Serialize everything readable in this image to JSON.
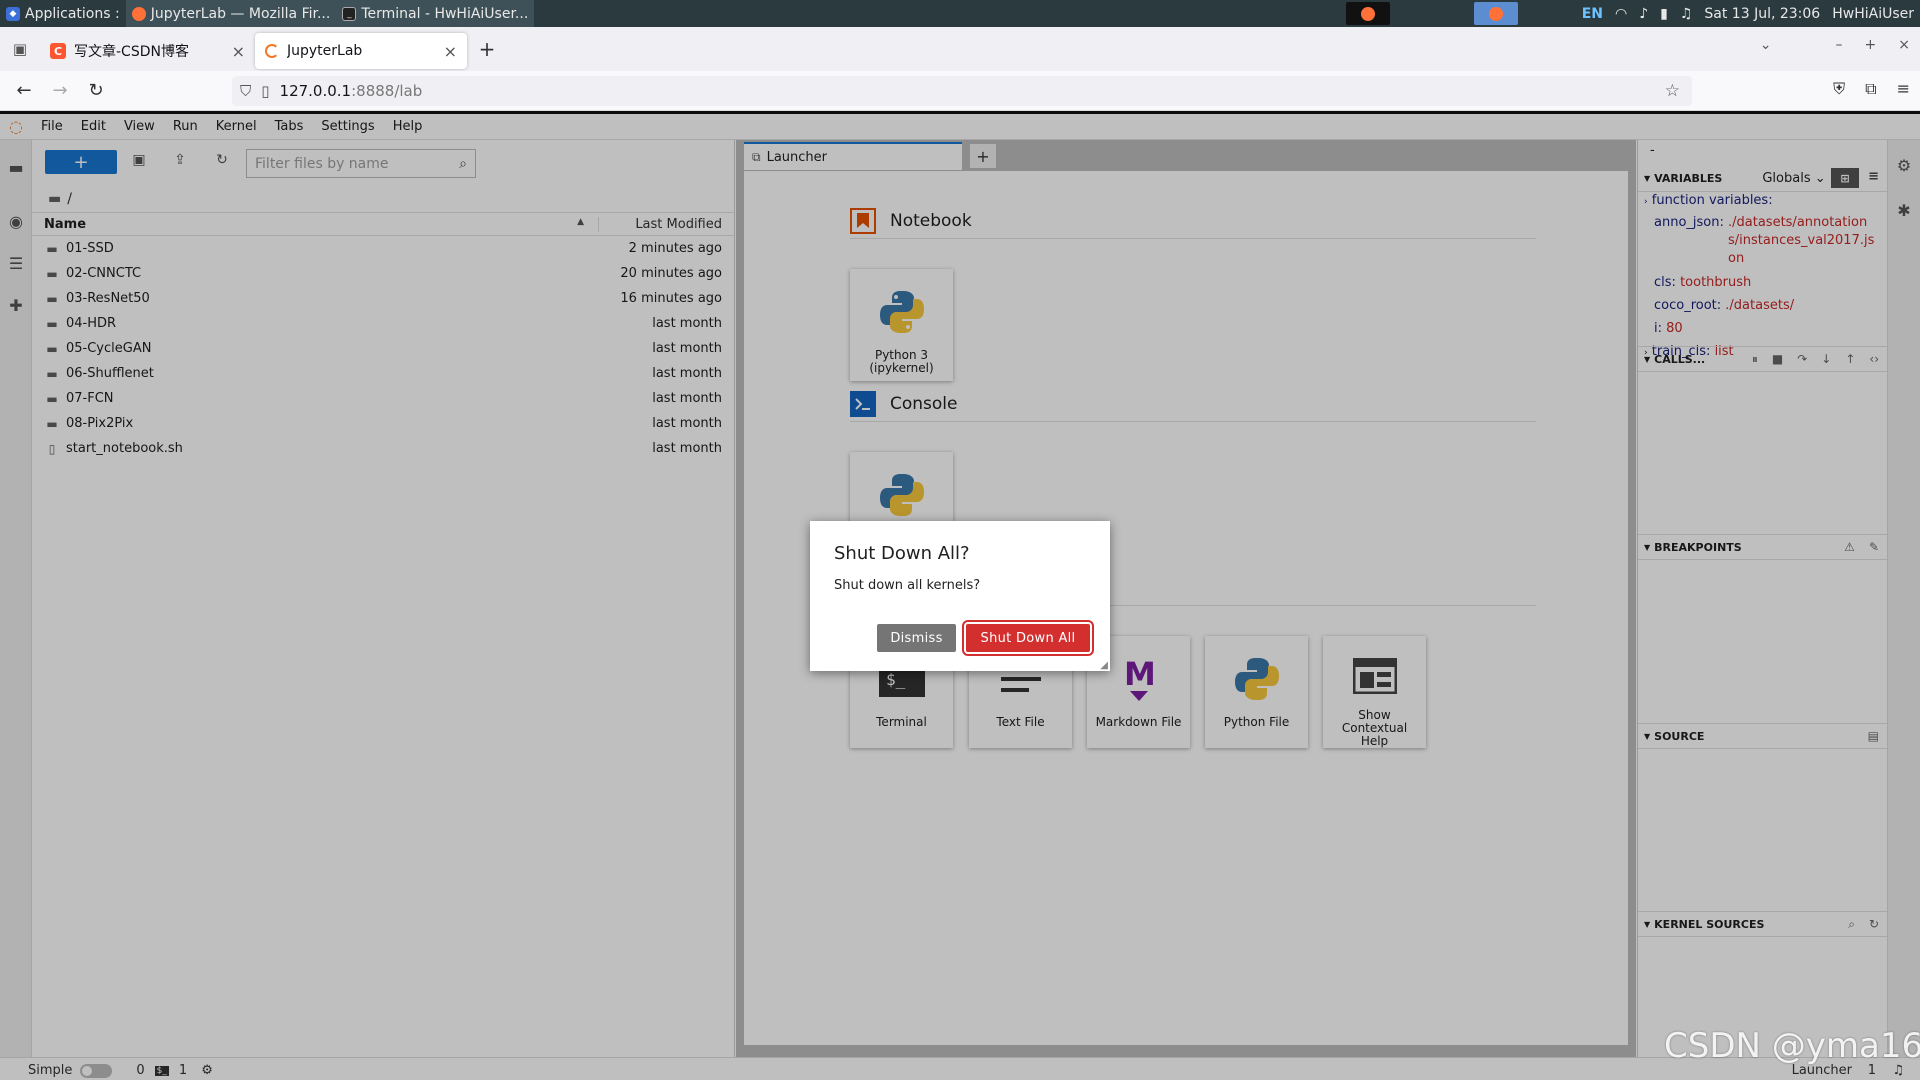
{
  "os_bar": {
    "tasks": [
      "Applications :",
      "JupyterLab — Mozilla Fir...",
      "Terminal - HwHiAiUser..."
    ],
    "lang": "EN",
    "datetime": "Sat 13 Jul, 23:06",
    "user": "HwHiAiUser"
  },
  "browser": {
    "tabs": [
      {
        "title": "写文章-CSDN博客",
        "active": false
      },
      {
        "title": "JupyterLab",
        "active": true
      }
    ],
    "url_host": "127.0.0.1",
    "url_rest": ":8888/lab"
  },
  "menu": [
    "File",
    "Edit",
    "View",
    "Run",
    "Kernel",
    "Tabs",
    "Settings",
    "Help"
  ],
  "file_browser": {
    "new_label": "+",
    "filter_placeholder": "Filter files by name",
    "breadcrumb": "/",
    "col_name": "Name",
    "col_modified": "Last Modified",
    "items": [
      {
        "name": "01-SSD",
        "type": "folder",
        "modified": "2 minutes ago"
      },
      {
        "name": "02-CNNCTC",
        "type": "folder",
        "modified": "20 minutes ago"
      },
      {
        "name": "03-ResNet50",
        "type": "folder",
        "modified": "16 minutes ago"
      },
      {
        "name": "04-HDR",
        "type": "folder",
        "modified": "last month"
      },
      {
        "name": "05-CycleGAN",
        "type": "folder",
        "modified": "last month"
      },
      {
        "name": "06-Shufflenet",
        "type": "folder",
        "modified": "last month"
      },
      {
        "name": "07-FCN",
        "type": "folder",
        "modified": "last month"
      },
      {
        "name": "08-Pix2Pix",
        "type": "folder",
        "modified": "last month"
      },
      {
        "name": "start_notebook.sh",
        "type": "file",
        "modified": "last month"
      }
    ]
  },
  "launcher": {
    "tab_title": "Launcher",
    "notebook_section": "Notebook",
    "console_section": "Console",
    "notebook_card": "Python 3 (ipykernel)",
    "other_cards": [
      "Terminal",
      "Text File",
      "Markdown File",
      "Python File",
      "Show Contextual Help"
    ]
  },
  "debugger": {
    "top_label": "-",
    "variables_title": "VARIABLES",
    "scope": "Globals",
    "function_vars": "function variables:",
    "vars": [
      {
        "key": "anno_json:",
        "value": "./datasets/annotations/instances_val2017.json"
      },
      {
        "key": "cls:",
        "value": "toothbrush"
      },
      {
        "key": "coco_root:",
        "value": "./datasets/"
      },
      {
        "key": "i:",
        "value": "80"
      },
      {
        "key": "train_cls:",
        "value": "list"
      }
    ],
    "callstack_title": "CALLS...",
    "breakpoints_title": "BREAKPOINTS",
    "source_title": "SOURCE",
    "kernel_sources_title": "KERNEL SOURCES"
  },
  "status_bar": {
    "mode": "Simple",
    "count_a": "0",
    "count_b": "1",
    "right_label": "Launcher",
    "right_count": "1"
  },
  "dialog": {
    "title": "Shut Down All?",
    "body": "Shut down all kernels?",
    "dismiss": "Dismiss",
    "confirm": "Shut Down All"
  },
  "watermark": "CSDN @yma16"
}
